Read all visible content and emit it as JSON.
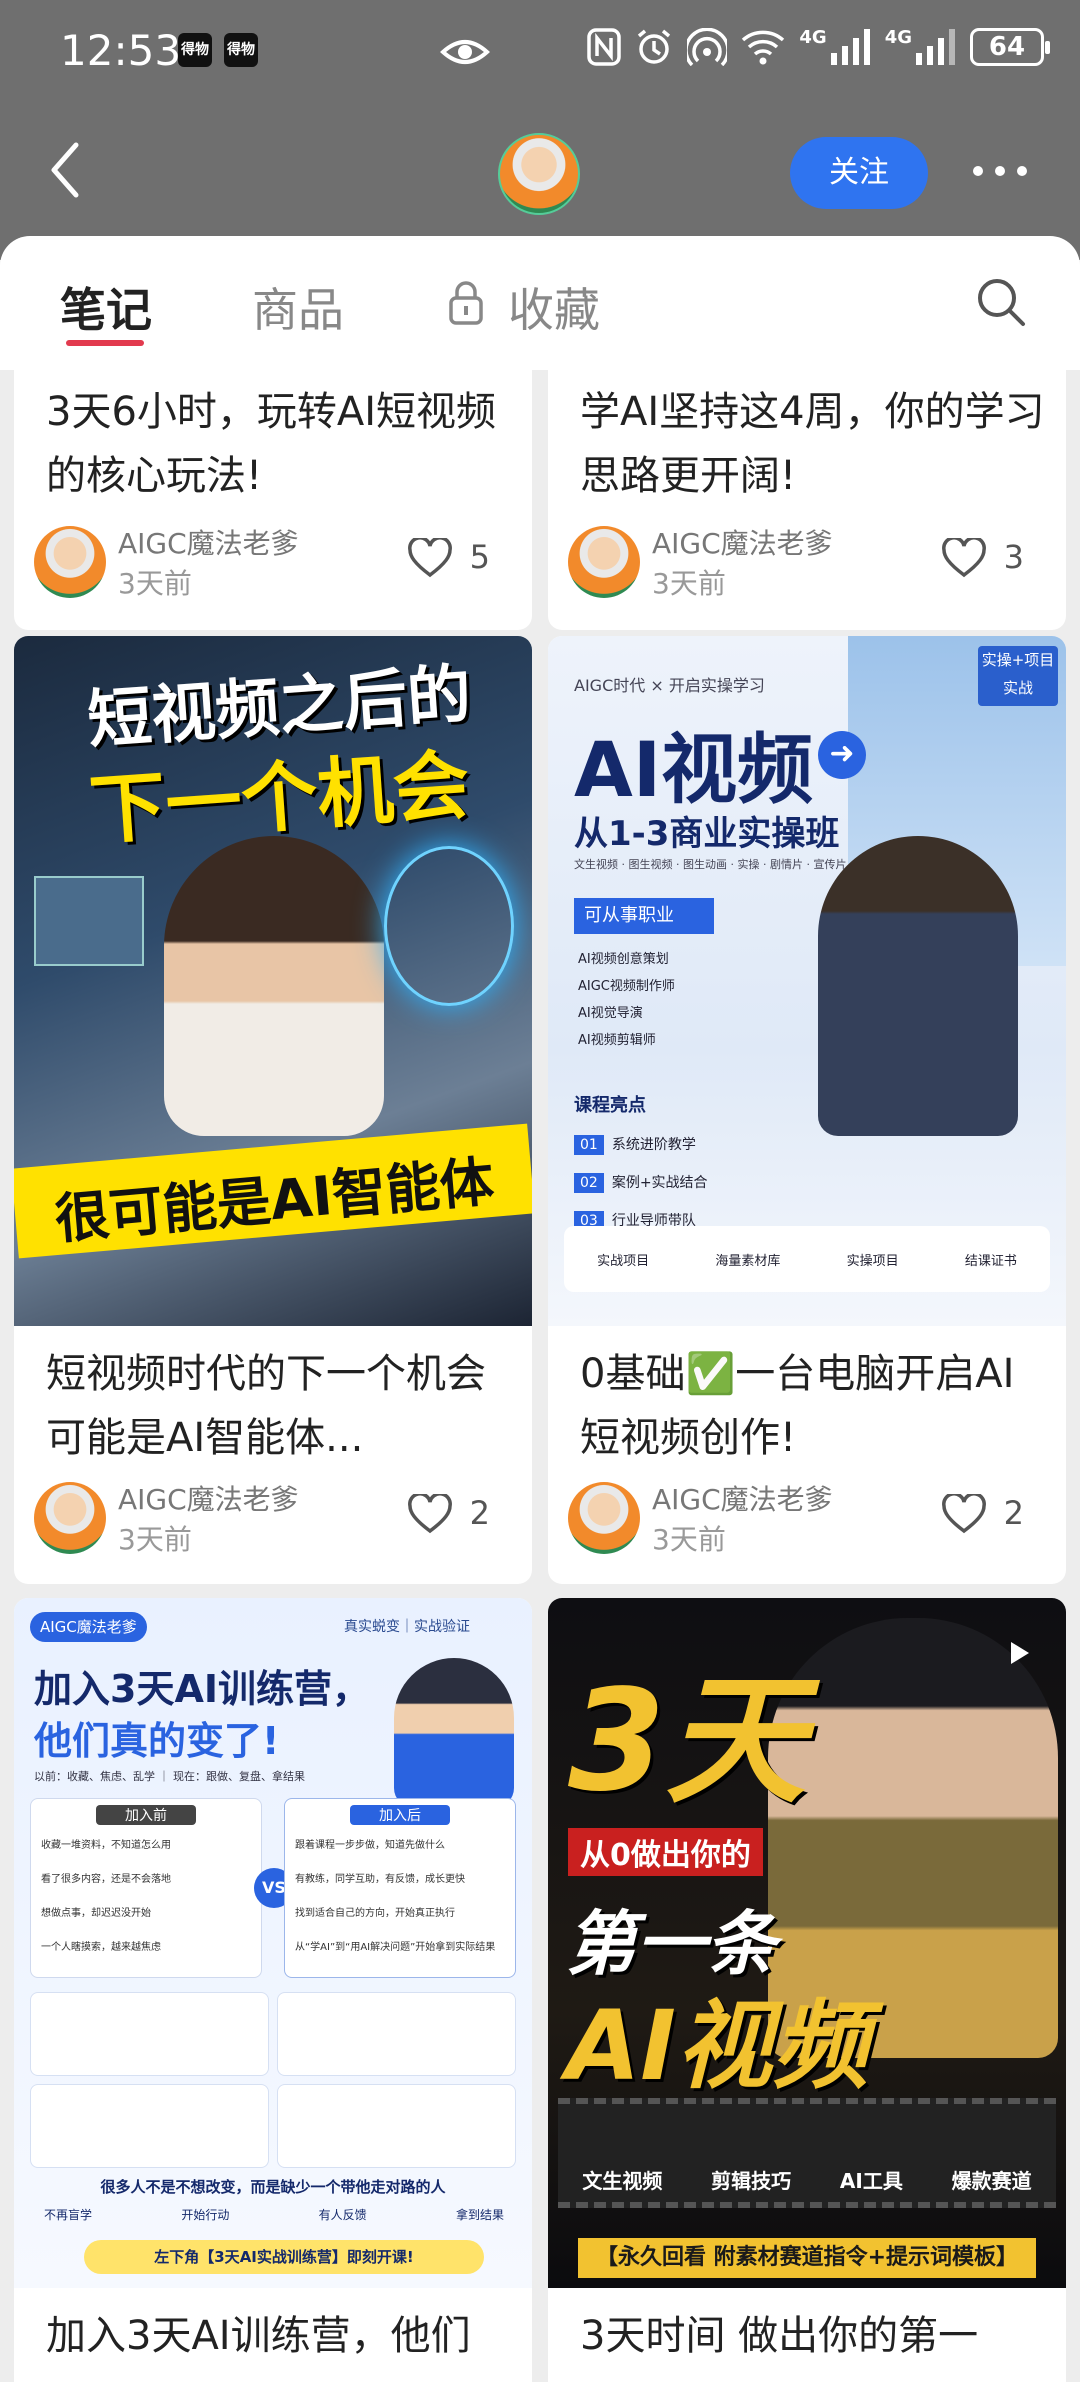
{
  "status": {
    "time": "12:53",
    "app_icon_1": "得物",
    "app_icon_2": "得物",
    "battery": "64",
    "icons": [
      "eye-icon",
      "nfc-icon",
      "alarm-icon",
      "hotspot-icon",
      "wifi-icon",
      "signal-4g-icon",
      "signal-4g-icon"
    ],
    "net1": "4G",
    "net2": "4G"
  },
  "header": {
    "follow_label": "关注"
  },
  "tabs": {
    "notes": "笔记",
    "products": "商品",
    "favorites": "收藏"
  },
  "cards": [
    {
      "title": "3天6小时，玩转AI短视频的核心玩法!",
      "author": "AIGC魔法老爹",
      "time": "3天前",
      "likes": "5"
    },
    {
      "title": "学AI坚持这4周，你的学习思路更开阔!",
      "author": "AIGC魔法老爹",
      "time": "3天前",
      "likes": "3"
    },
    {
      "title": "短视频时代的下一个机会 可能是AI智能体...",
      "author": "AIGC魔法老爹",
      "time": "3天前",
      "likes": "2",
      "cover": {
        "line1": "短视频之后的",
        "line2": "下一个机会",
        "line3": "很可能是AI智能体"
      }
    },
    {
      "title": "0基础✅一台电脑开启AI短视频创作!",
      "author": "AIGC魔法老爹",
      "time": "3天前",
      "likes": "2",
      "cover": {
        "badge": "实操+项目实战",
        "brand": "AIGC时代 × 开启实操学习",
        "line1": "AI视频",
        "line2": "从1-3商业实操班",
        "sub": "文生视频 · 图生视频 · 图生动画 · 实操 · 剧情片 · 宣传片 · 科普视频等",
        "jobs_title": "可从事职业",
        "jobs": [
          "AI视频创意策划",
          "AIGC视频制作师",
          "AI视觉导演",
          "AI视频剪辑师"
        ],
        "highlights_title": "课程亮点",
        "highlights": [
          "系统进阶教学",
          "案例+实战结合",
          "行业导师带队"
        ],
        "footer_items": [
          "实战项目",
          "海量素材库",
          "实操项目",
          "结课证书"
        ]
      }
    },
    {
      "title": "加入3天AI训练营，他们",
      "cover": {
        "brand": "AIGC魔法老爹",
        "tag": "真实蜕变｜实战验证",
        "line1": "加入3天AI训练营，",
        "line2": "他们真的变了!",
        "compare": "以前：收藏、焦虑、乱学 ｜ 现在：跟做、复盘、拿结果",
        "before_label": "加入前",
        "after_label": "加入后",
        "before": [
          "收藏一堆资料，不知道怎么用",
          "看了很多内容，还是不会落地",
          "想做点事，却迟迟没开始",
          "一个人瞎摸索，越来越焦虑"
        ],
        "after": [
          "跟着课程一步步做，知道先做什么",
          "有教练，同学互助，有反馈，成长更快",
          "找到适合自己的方向，开始真正执行",
          "从“学AI”到“用AI解决问题”开始拿到实际结果"
        ],
        "quote": "很多人不是不想改变，而是缺少一个带他走对路的人",
        "steps": [
          "不再盲学",
          "开始行动",
          "有人反馈",
          "拿到结果"
        ],
        "cta": "左下角【3天AI实战训练营】即刻开课!"
      }
    },
    {
      "title": "3天时间 做出你的第一",
      "cover": {
        "line1": "3天",
        "line2": "从0做出你的",
        "line3": "第一条",
        "line4": "AI视频",
        "labels": [
          "文生视频",
          "剪辑技巧",
          "AI工具",
          "爆款赛道"
        ],
        "bottom": "【永久回看 附素材赛道指令+提示词模板】"
      }
    }
  ]
}
